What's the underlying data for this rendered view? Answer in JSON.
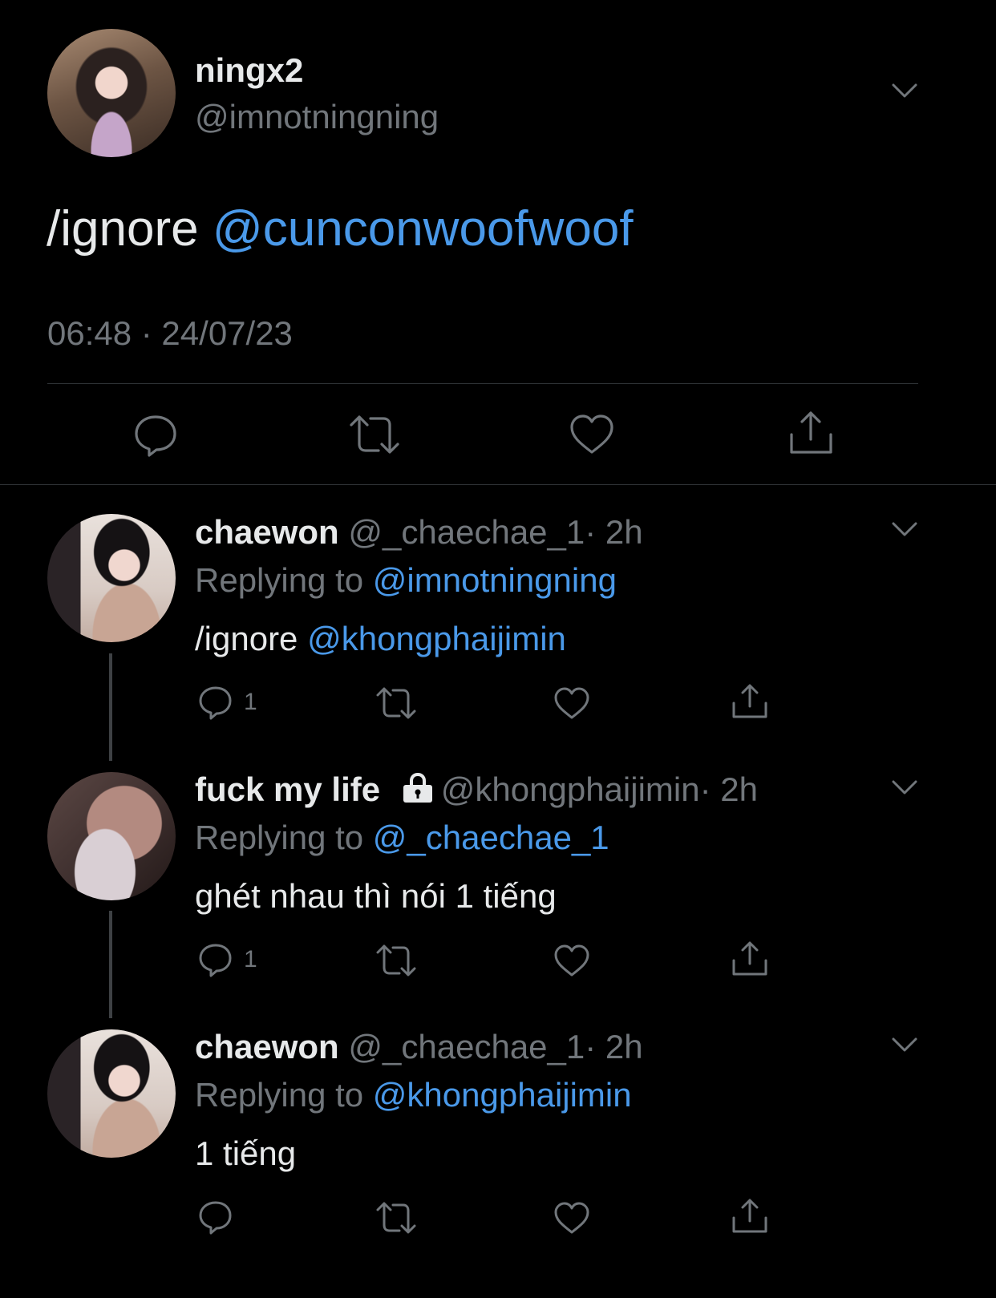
{
  "main_tweet": {
    "display_name": "ningx2",
    "handle": "@imnotningning",
    "text_prefix": "/ignore ",
    "mention": "@cunconwoofwoof",
    "timestamp": "06:48 · 24/07/23",
    "actions": [
      "reply-icon",
      "retweet-icon",
      "like-icon",
      "share-icon"
    ]
  },
  "replies": [
    {
      "display_name": "chaewon",
      "handle": "@_chaechae_1",
      "time": "· 2h",
      "replying_label": "Replying to ",
      "replying_to": "@imnotningning",
      "text_prefix": "/ignore ",
      "mention": "@khongphaijimin",
      "reply_count": "1"
    },
    {
      "display_name": "fuck my life",
      "locked": true,
      "handle": "@khongphaijimin",
      "time": "· 2h",
      "replying_label": "Replying to ",
      "replying_to": "@_chaechae_1",
      "text": "ghét nhau thì nói 1 tiếng",
      "reply_count": "1"
    },
    {
      "display_name": "chaewon",
      "handle": "@_chaechae_1",
      "time": "· 2h",
      "replying_label": "Replying to ",
      "replying_to": "@khongphaijimin",
      "text": "1 tiếng",
      "reply_count": ""
    }
  ],
  "colors": {
    "background": "#000000",
    "text": "#e7e9ea",
    "muted": "#71767b",
    "link": "#4a99e9",
    "divider": "#2f3336"
  }
}
